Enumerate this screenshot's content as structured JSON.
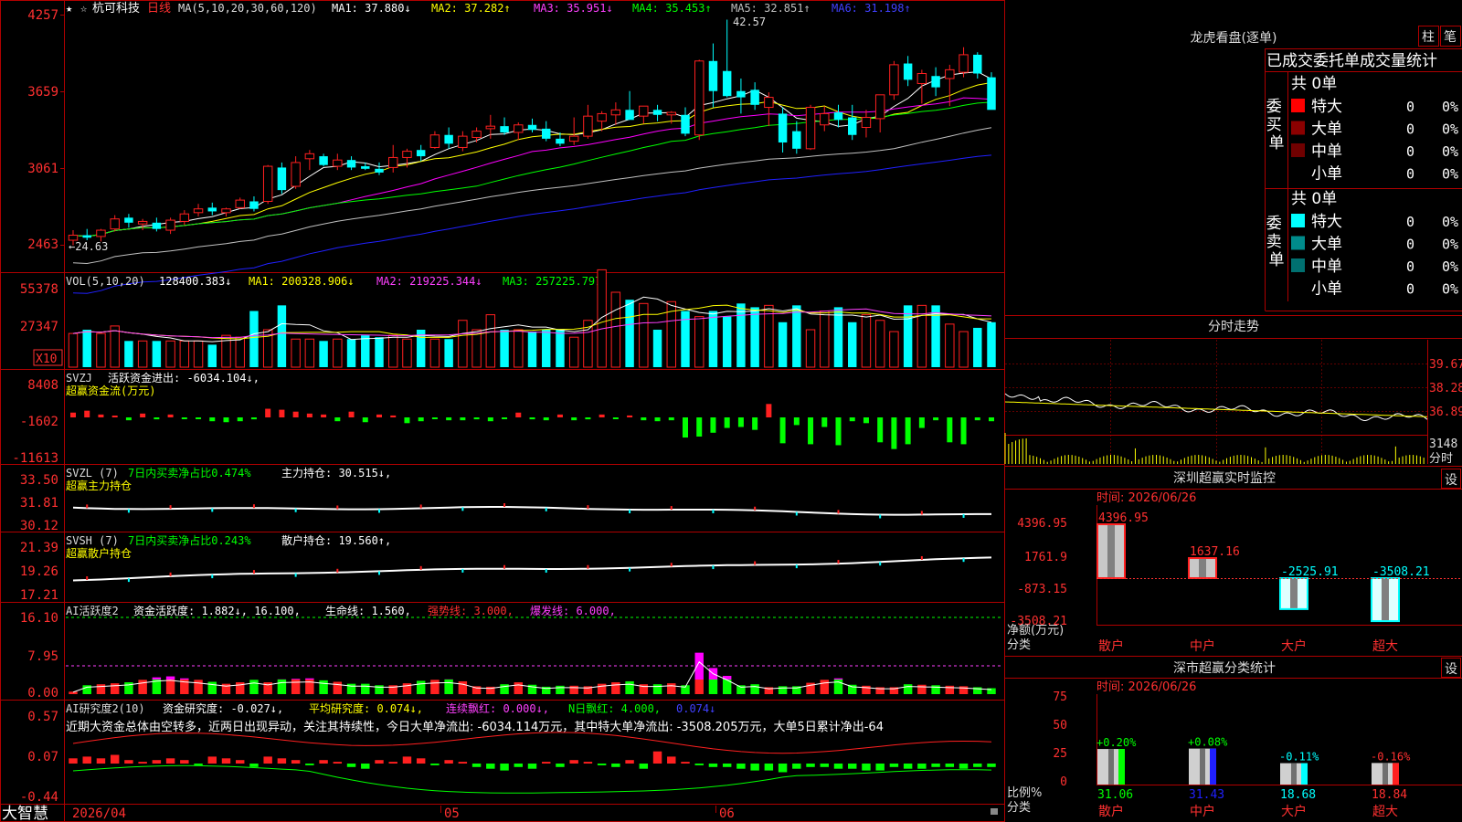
{
  "app": {
    "brand": "大智慧",
    "zoom_label": "X10"
  },
  "colors": {
    "up": "#ff2020",
    "down": "#00ffff",
    "frame": "#b00000",
    "white": "#ffffff",
    "yellow": "#ffff00",
    "magenta": "#ff00ff",
    "green": "#00ff00",
    "blue": "#2020ff",
    "gray": "#c0c0c0"
  },
  "main": {
    "stock_name": "杭可科技",
    "period": "日线",
    "header": [
      "MA(5,10,20,30,60,120)",
      "MA1: 37.880↓",
      "MA2: 37.282↑",
      "MA3: 35.951↓",
      "MA4: 35.453↑",
      "MA5: 32.851↑",
      "MA6: 31.198↑"
    ],
    "axis_labels": [
      "4257",
      "3659",
      "3061",
      "2463"
    ],
    "high_label": "42.57",
    "low_label": "←24.63",
    "candles": [
      [
        25.0,
        25.8,
        24.6,
        25.4
      ],
      [
        25.4,
        25.9,
        25.0,
        25.2
      ],
      [
        25.3,
        25.9,
        24.9,
        25.8
      ],
      [
        25.9,
        27.0,
        25.7,
        26.7
      ],
      [
        26.8,
        27.1,
        26.0,
        26.4
      ],
      [
        26.3,
        26.7,
        25.8,
        26.5
      ],
      [
        26.4,
        26.8,
        25.7,
        25.9
      ],
      [
        25.8,
        26.8,
        25.5,
        26.6
      ],
      [
        26.5,
        27.4,
        26.2,
        27.1
      ],
      [
        27.2,
        27.9,
        26.9,
        27.5
      ],
      [
        27.6,
        28.0,
        27.0,
        27.3
      ],
      [
        27.2,
        27.6,
        26.9,
        27.5
      ],
      [
        27.6,
        28.4,
        27.5,
        28.2
      ],
      [
        28.1,
        28.5,
        27.3,
        27.5
      ],
      [
        28.1,
        31.0,
        27.9,
        30.9
      ],
      [
        30.8,
        31.2,
        28.7,
        29.0
      ],
      [
        29.3,
        31.7,
        29.1,
        31.2
      ],
      [
        31.5,
        32.2,
        30.6,
        31.9
      ],
      [
        31.7,
        31.9,
        30.9,
        31.0
      ],
      [
        30.9,
        31.9,
        30.6,
        31.4
      ],
      [
        31.4,
        31.7,
        30.6,
        30.8
      ],
      [
        30.9,
        31.2,
        30.6,
        30.7
      ],
      [
        30.7,
        31.2,
        30.2,
        30.4
      ],
      [
        30.8,
        32.6,
        30.4,
        31.6
      ],
      [
        31.6,
        32.3,
        30.8,
        32.1
      ],
      [
        32.2,
        32.6,
        31.3,
        31.7
      ],
      [
        32.4,
        33.7,
        32.3,
        33.4
      ],
      [
        33.4,
        34.0,
        32.3,
        32.7
      ],
      [
        32.4,
        33.7,
        32.1,
        33.3
      ],
      [
        33.2,
        34.0,
        32.8,
        33.7
      ],
      [
        33.9,
        35.0,
        33.1,
        34.1
      ],
      [
        34.1,
        34.8,
        33.4,
        33.6
      ],
      [
        33.6,
        34.4,
        33.0,
        34.2
      ],
      [
        34.2,
        34.7,
        33.6,
        33.8
      ],
      [
        33.9,
        34.5,
        32.9,
        33.1
      ],
      [
        33.1,
        33.6,
        32.5,
        32.7
      ],
      [
        32.9,
        34.8,
        32.6,
        33.3
      ],
      [
        33.3,
        35.8,
        33.1,
        34.9
      ],
      [
        34.5,
        35.3,
        33.7,
        35.1
      ],
      [
        35.0,
        36.0,
        34.2,
        35.4
      ],
      [
        35.4,
        36.9,
        35.0,
        34.6
      ],
      [
        34.9,
        35.7,
        34.3,
        35.7
      ],
      [
        35.4,
        35.8,
        34.5,
        35.0
      ],
      [
        35.0,
        35.3,
        34.3,
        35.2
      ],
      [
        35.0,
        35.6,
        33.3,
        33.5
      ],
      [
        33.4,
        39.4,
        33.0,
        39.3
      ],
      [
        39.3,
        40.7,
        35.6,
        36.9
      ],
      [
        38.5,
        42.6,
        36.4,
        36.5
      ],
      [
        36.9,
        37.9,
        35.1,
        36.4
      ],
      [
        37.0,
        37.6,
        35.4,
        35.8
      ],
      [
        35.6,
        36.8,
        34.1,
        36.4
      ],
      [
        35.1,
        35.6,
        32.0,
        32.8
      ],
      [
        33.7,
        34.5,
        31.9,
        32.3
      ],
      [
        32.3,
        35.8,
        32.2,
        35.6
      ],
      [
        34.2,
        35.7,
        33.7,
        35.1
      ],
      [
        35.2,
        35.8,
        34.0,
        34.6
      ],
      [
        34.8,
        35.8,
        33.0,
        33.4
      ],
      [
        34.0,
        35.4,
        33.2,
        34.8
      ],
      [
        34.7,
        36.0,
        33.6,
        36.6
      ],
      [
        36.6,
        39.3,
        36.2,
        39.0
      ],
      [
        39.1,
        39.7,
        37.3,
        37.8
      ],
      [
        37.5,
        38.6,
        35.9,
        38.3
      ],
      [
        38.1,
        38.8,
        36.5,
        37.2
      ],
      [
        37.9,
        39.0,
        35.7,
        38.6
      ],
      [
        38.4,
        40.4,
        38.0,
        39.8
      ],
      [
        39.8,
        40.0,
        37.9,
        38.3
      ],
      [
        38.0,
        38.4,
        35.5,
        35.4
      ]
    ],
    "ma_colors": [
      "#ffffff",
      "#ffff00",
      "#ff00ff",
      "#00ff00",
      "#c0c0c0",
      "#2020ff"
    ]
  },
  "vol": {
    "header": [
      "VOL(5,10,20)",
      "128400.383↓",
      "MA1: 200328.906↓",
      "MA2: 219225.344↓",
      "MA3: 257225.797↓"
    ],
    "axis_labels": [
      "55378",
      "27347"
    ],
    "values": [
      18,
      20,
      18,
      22,
      14,
      14,
      14,
      14,
      14,
      14,
      12,
      17,
      16,
      30,
      20,
      33,
      15,
      15,
      14,
      15,
      15,
      17,
      16,
      17,
      15,
      20,
      15,
      15,
      25,
      20,
      28,
      20,
      20,
      19,
      20,
      20,
      16,
      25,
      52,
      40,
      36,
      34,
      20,
      35,
      30,
      27,
      30,
      27,
      34,
      32,
      33,
      24,
      33,
      20,
      30,
      32,
      24,
      28,
      25,
      19,
      33,
      33,
      33,
      23,
      19,
      21,
      24
    ]
  },
  "svzj": {
    "header_name": "SVZJ",
    "header_value": "活跃资金进出: -6034.104↓,",
    "subtitle": "超赢资金流(万元)",
    "axis_labels": [
      "8408",
      "-1602",
      "-11613"
    ],
    "values": [
      0.4,
      -0.3,
      -0.6,
      0.4,
      -0.2,
      -0.1,
      -0.2,
      -0.4,
      -0.1,
      -0.1,
      -0.6,
      -0.2,
      0.3,
      0.6,
      -1.1,
      -0.6,
      -0.2,
      -0.3,
      -0.1,
      -0.2,
      1.8,
      0.2,
      0.3,
      0.4,
      -0.6,
      -0.3,
      -0.4,
      -0.7,
      -0.2,
      -0.3,
      -0.4,
      -0.4,
      -0.3,
      0.2,
      -0.5,
      -0.9,
      -0.8,
      -0.2,
      -0.3,
      -1.3,
      -4.4,
      -3.3,
      -3.7,
      -0.1,
      0.5,
      -0.2,
      -0.3,
      -0.7,
      -0.8,
      0.1,
      -0.4,
      0.3,
      -0.7,
      -0.5,
      1.1,
      -0.6,
      0.9,
      0.8,
      -0.2,
      1.2,
      -0.3,
      -0.2,
      -1.4,
      -0.2,
      -0.3,
      1.0,
      -0.1,
      0.2,
      -0.3,
      0.4,
      0.2,
      0.9,
      -0.4,
      -0.5,
      -0.6,
      -0.7,
      -0.6,
      -0.5,
      -0.4,
      -0.3,
      -0.2,
      -0.1
    ],
    "bars": [
      0.5,
      0.7,
      0.3,
      0,
      -0.3,
      0.4,
      -0.2,
      0.3,
      -0.1,
      -0.1,
      -0.4,
      -0.5,
      -0.4,
      -0.2,
      0.9,
      0.8,
      0.6,
      0.4,
      0.3,
      -0.4,
      0.6,
      -0.5,
      0.3,
      0.2,
      -0.6,
      -0.4,
      -0.1,
      -0.3,
      -0.3,
      -0.2,
      -0.4,
      -0.1,
      0.5,
      -0.2,
      -0.3,
      0.3,
      -0.3,
      -0.2,
      0.3,
      -0.1,
      0.2,
      -0.3,
      -0.4,
      -0.3,
      -2.1,
      -2.0,
      -1.6,
      -1.1,
      -1.0,
      -1.3,
      1.4,
      -2.7,
      -0.8,
      -2.8,
      -1.0,
      -2.9,
      -0.4,
      -0.6,
      -2.6,
      -3.3,
      -2.8,
      -1.1,
      -0.3,
      -2.6,
      -2.8,
      -0.3,
      -0.4,
      -0.5
    ],
    "axis_range": [
      -11613,
      8408
    ]
  },
  "svzl": {
    "header_name": "SVZL (7)",
    "header_green": "7日内买卖净占比0.474%",
    "header_white": "主力持仓: 30.515↓,",
    "subtitle": "超赢主力持仓",
    "axis_labels": [
      "33.50",
      "31.81",
      "30.12"
    ]
  },
  "svsh": {
    "header_name": "SVSH (7)",
    "header_green": "7日内买卖净占比0.243%",
    "header_white": "散户持仓: 19.560↑,",
    "subtitle": "超赢散户持仓",
    "axis_labels": [
      "21.39",
      "19.26",
      "17.21"
    ]
  },
  "ai1": {
    "header": [
      "AI活跃度2",
      "资金活跃度: 1.882↓, 16.100,",
      "生命线: 1.560,",
      "强势线: 3.000,",
      "爆发线: 6.000,"
    ],
    "axis_labels": [
      "16.10",
      "7.95",
      "0.00"
    ]
  },
  "ai2": {
    "header": [
      "AI研究度2(10)",
      "资金研究度: -0.027↓,",
      "平均研究度: 0.074↓,",
      "连续飘红: 0.000↓,",
      "N日飘红: 4.000,",
      "0.074↓"
    ],
    "note": "近期大资金总体由空转多，近两日出现异动，关注其持续性，今日大单净流出: -6034.114万元，其中特大单净流出: -3508.205万元，大单5日累计净出-64",
    "axis_labels": [
      "0.57",
      "0.07",
      "-0.44"
    ]
  },
  "dates": [
    "2026/04",
    "05",
    "06"
  ],
  "right": {
    "lhb_title": "龙虎看盘(逐单)",
    "tab_bar": "柱",
    "tab_pen": "笔",
    "stat_header": "已成交委托单成交量统计",
    "buy_group_label": "委买单",
    "sell_group_label": "委卖单",
    "buy_total": "共 0单",
    "sell_total": "共 0单",
    "buy_rows": [
      {
        "label": "特大",
        "value": "0",
        "pct": "0%",
        "color": "#ff0000"
      },
      {
        "label": "大单",
        "value": "0",
        "pct": "0%",
        "color": "#8b0000"
      },
      {
        "label": "中单",
        "value": "0",
        "pct": "0%",
        "color": "#700000"
      },
      {
        "label": "小单",
        "value": "0",
        "pct": "0%",
        "color": ""
      }
    ],
    "sell_rows": [
      {
        "label": "特大",
        "value": "0",
        "pct": "0%",
        "color": "#00ffff"
      },
      {
        "label": "大单",
        "value": "0",
        "pct": "0%",
        "color": "#008b8b"
      },
      {
        "label": "中单",
        "value": "0",
        "pct": "0%",
        "color": "#007070"
      },
      {
        "label": "小单",
        "value": "0",
        "pct": "0%",
        "color": ""
      }
    ],
    "intraday_title": "分时走势",
    "intraday_axis": [
      "39.67",
      "38.28",
      "36.89",
      "3148",
      "分时"
    ],
    "monitor_title": "深圳超赢实时监控",
    "monitor_settings": "设",
    "monitor_time": "时间: 2026/06/26",
    "monitor_axis": [
      "4396.95",
      "1761.9",
      "-873.15",
      "-3508.21"
    ],
    "monitor_ylabel1": "净额(万元)",
    "monitor_ylabel2": "分类",
    "monitor_bars": [
      {
        "label": "散户",
        "value": 4396.95,
        "text": "4396.95"
      },
      {
        "label": "中户",
        "value": 1637.16,
        "text": "1637.16"
      },
      {
        "label": "大户",
        "value": -2525.91,
        "text": "-2525.91"
      },
      {
        "label": "超大",
        "value": -3508.21,
        "text": "-3508.21"
      }
    ],
    "stats_title": "深市超赢分类统计",
    "stats_settings": "设",
    "stats_time": "时间: 2026/06/26",
    "stats_axis": [
      "75",
      "50",
      "25",
      "0"
    ],
    "stats_ylabel1": "比例%",
    "stats_ylabel2": "分类",
    "stats_bars": [
      {
        "label": "散户",
        "value": 31.06,
        "delta": "+0.20%",
        "color": "#00ff00"
      },
      {
        "label": "中户",
        "value": 31.43,
        "delta": "+0.08%",
        "color": "#2020ff"
      },
      {
        "label": "大户",
        "value": 18.68,
        "delta": "-0.11%",
        "color": "#00ffff"
      },
      {
        "label": "超大",
        "value": 18.84,
        "delta": "-0.16%",
        "color": "#ff2020"
      }
    ]
  }
}
